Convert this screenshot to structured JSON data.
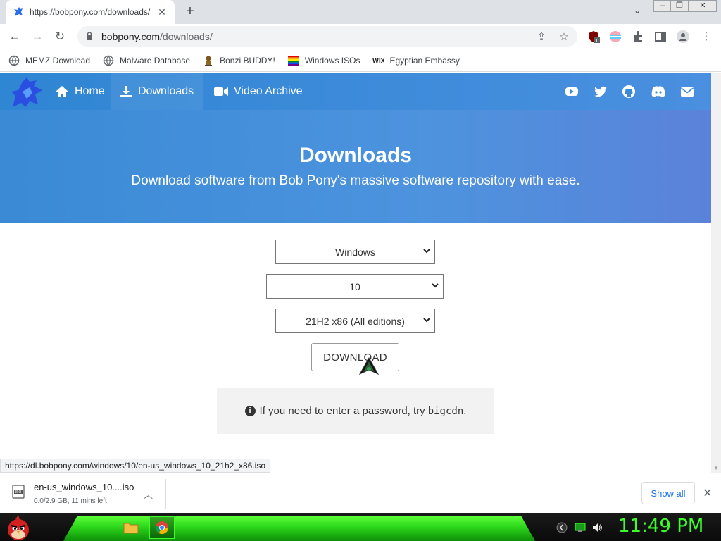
{
  "browser": {
    "tab_title": "https://bobpony.com/downloads/",
    "omnibox_domain": "bobpony.com",
    "omnibox_path": "/downloads/",
    "extension_badge": "1"
  },
  "bookmarks": [
    {
      "label": "MEMZ Download"
    },
    {
      "label": "Malware Database"
    },
    {
      "label": "Bonzi BUDDY!"
    },
    {
      "label": "Windows ISOs"
    },
    {
      "label": "Egyptian Embassy"
    }
  ],
  "nav": {
    "home": "Home",
    "downloads": "Downloads",
    "video_archive": "Video Archive"
  },
  "hero": {
    "title": "Downloads",
    "subtitle": "Download software from Bob Pony's massive software repository with ease."
  },
  "form": {
    "os_selected": "Windows",
    "version_selected": "10",
    "edition_selected": "21H2 x86 (All editions)",
    "download_label": "DOWNLOAD"
  },
  "notice": {
    "text": "If you need to enter a password, try",
    "password": "bigcdn",
    "suffix": "."
  },
  "status_url": "https://dl.bobpony.com/windows/10/en-us_windows_10_21h2_x86.iso",
  "download_shelf": {
    "filename": "en-us_windows_10....iso",
    "status": "0.0/2.9 GB, 11 mins left",
    "show_all": "Show all"
  },
  "taskbar": {
    "clock": "11:49 PM"
  },
  "colors": {
    "navbar": "#2f86d3",
    "hero": "#4a8fe0",
    "clock": "#3cff2a",
    "taskbar_glow": "#2bd61a"
  }
}
